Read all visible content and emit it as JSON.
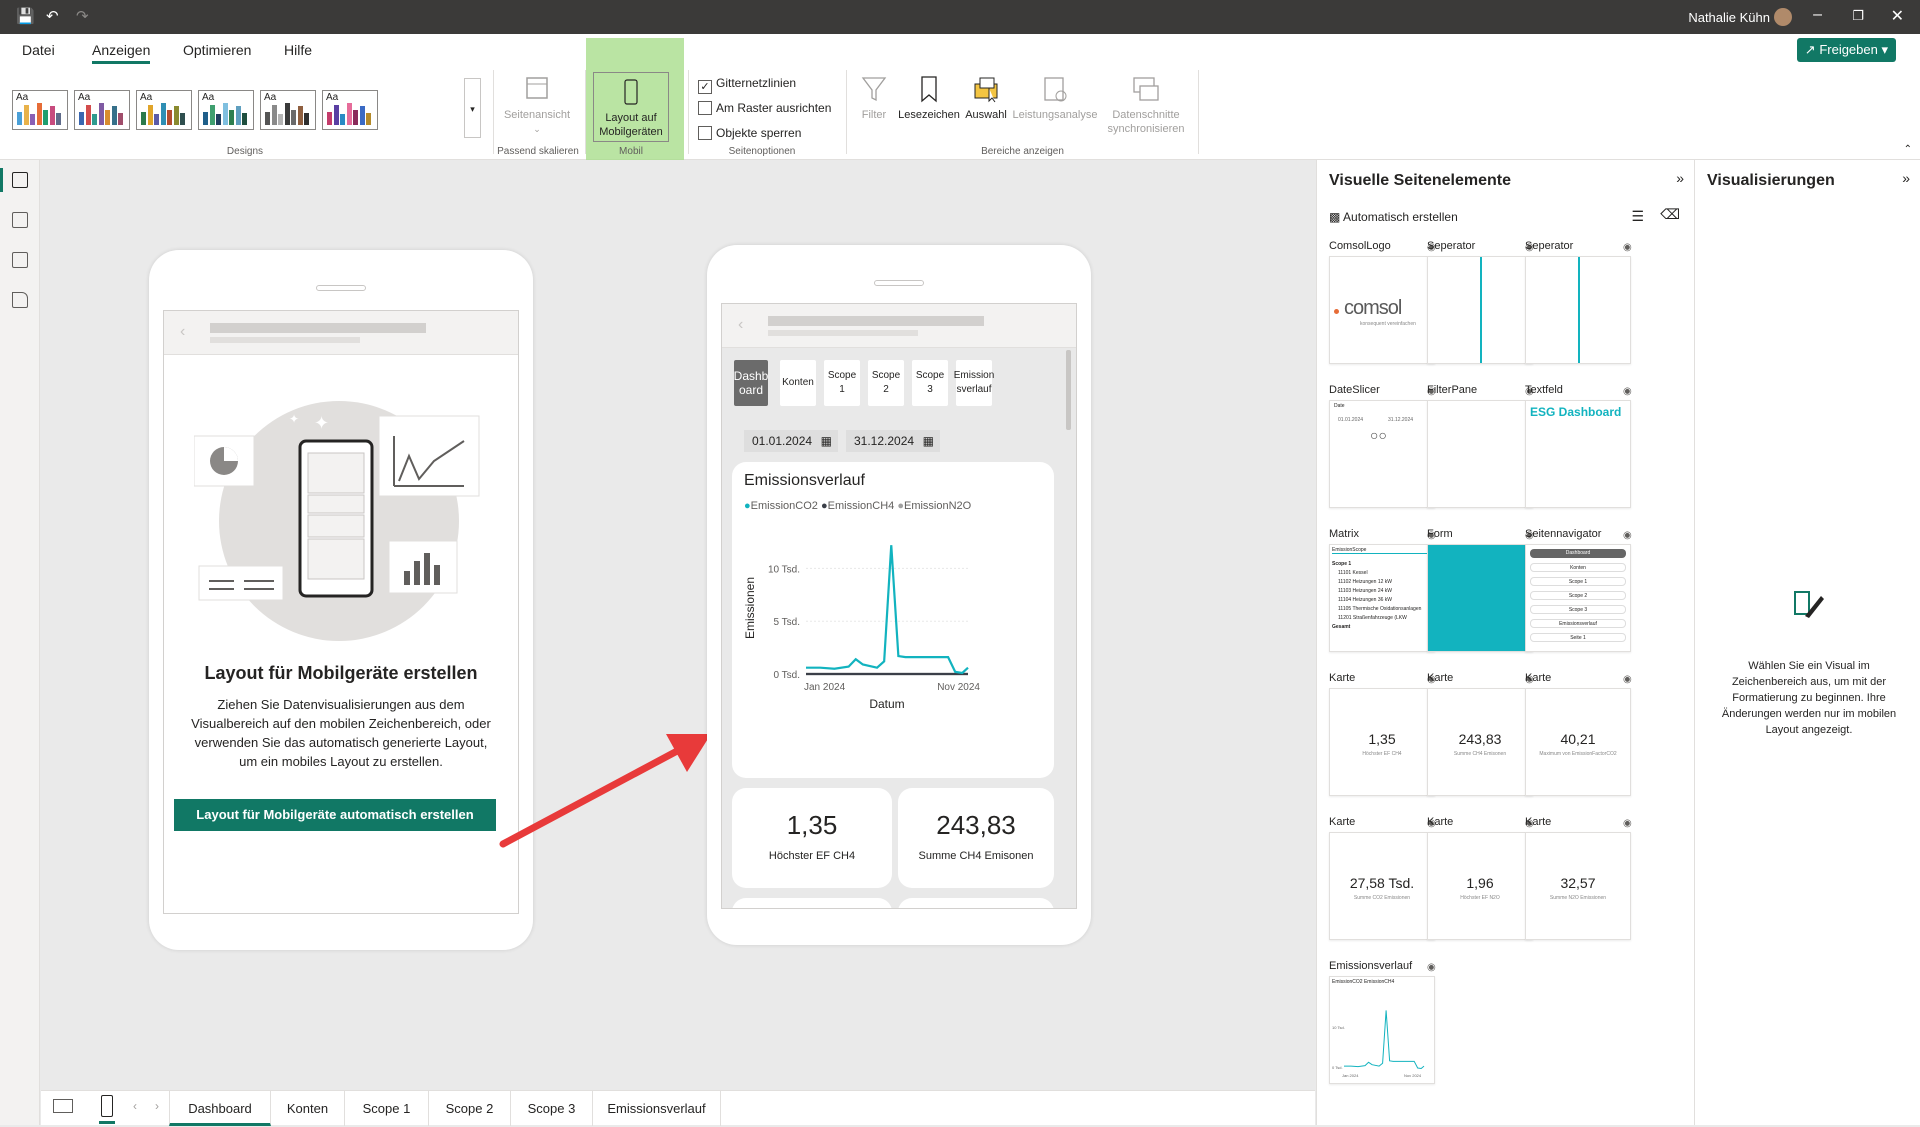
{
  "titlebar": {
    "user": "Nathalie Kühn"
  },
  "menu": {
    "tabs": [
      "Datei",
      "Anzeigen",
      "Optimieren",
      "Hilfe"
    ],
    "active": "Anzeigen",
    "share_label": "Freigeben"
  },
  "ribbon": {
    "groups": {
      "designs": "Designs",
      "fit": "Passend skalieren",
      "mobile": "Mobil",
      "pageopts": "Seitenoptionen",
      "panes": "Bereiche anzeigen"
    },
    "theme_label": "Aa",
    "page_view": "Seitenansicht",
    "mobile_layout": "Layout auf Mobilgeräten",
    "checkboxes": [
      {
        "label": "Gitternetzlinien",
        "checked": true
      },
      {
        "label": "Am Raster ausrichten",
        "checked": false
      },
      {
        "label": "Objekte sperren",
        "checked": false
      }
    ],
    "pane_buttons": [
      "Filter",
      "Lesezeichen",
      "Auswahl",
      "Leistungsanalyse",
      "Datenschnitte synchronisieren"
    ],
    "accent": "#117865",
    "highlight": "#a9dd8c"
  },
  "left_phone": {
    "heading": "Layout für Mobilgeräte erstellen",
    "body": "Ziehen Sie Datenvisualisierungen aus dem Visualbereich auf den mobilen Zeichenbereich, oder verwenden Sie das automatisch generierte Layout, um ein mobiles Layout zu erstellen.",
    "button": "Layout für Mobilgeräte automatisch erstellen"
  },
  "right_phone": {
    "nav": [
      "Dashb oard",
      "Konten",
      "Scope 1",
      "Scope 2",
      "Scope 3",
      "Emission sverlauf"
    ],
    "date_from": "01.01.2024",
    "date_to": "31.12.2024",
    "kpis": [
      {
        "value": "1,35",
        "label": "Höchster EF CH4"
      },
      {
        "value": "243,83",
        "label": "Summe CH4 Emisonen"
      }
    ]
  },
  "chart_data": {
    "type": "line",
    "title": "Emissionsverlauf",
    "xlabel": "Datum",
    "ylabel": "Emissionen",
    "x_ticks": [
      "Jan 2024",
      "Nov 2024"
    ],
    "y_ticks": [
      "0 Tsd.",
      "5 Tsd.",
      "10 Tsd."
    ],
    "ylim": [
      0,
      12500
    ],
    "legend": [
      "EmissionCO2",
      "EmissionCH4",
      "EmissionN2O"
    ],
    "series": [
      {
        "name": "EmissionCO2",
        "color": "#12b3bf",
        "x": [
          0,
          1,
          2,
          3,
          3.5,
          4,
          5,
          5.5,
          6,
          6.5,
          7,
          7.5,
          8,
          9,
          10,
          10.5,
          11,
          11.4
        ],
        "values": [
          600,
          600,
          500,
          700,
          1400,
          900,
          600,
          1200,
          12200,
          1700,
          1600,
          1600,
          1600,
          1600,
          1600,
          200,
          100,
          600
        ]
      },
      {
        "name": "EmissionCH4",
        "color": "#3b3f48",
        "x": [
          0,
          11.4
        ],
        "values": [
          0,
          0
        ]
      },
      {
        "name": "EmissionN2O",
        "color": "#a0a0a0",
        "x": [
          0,
          11.4
        ],
        "values": [
          0,
          0
        ]
      }
    ]
  },
  "visuals_pane": {
    "title": "Visuelle Seitenelemente",
    "auto_create": "Automatisch erstellen",
    "items": [
      {
        "label": "ComsolLogo",
        "kind": "logo",
        "content": "comsol",
        "sub": "konsequent vereinfachen"
      },
      {
        "label": "Seperator",
        "kind": "separator"
      },
      {
        "label": "Seperator",
        "kind": "separator"
      },
      {
        "label": "DateSlicer",
        "kind": "slicer",
        "content": "Date",
        "d1": "01.01.2024",
        "d2": "31.12.2024"
      },
      {
        "label": "FilterPane",
        "kind": "blank"
      },
      {
        "label": "Textfeld",
        "kind": "text",
        "content": "ESG Dashboard"
      },
      {
        "label": "Matrix",
        "kind": "matrix",
        "content": "EmissionScope",
        "rows": [
          "Scope 1",
          "11101 Kessel",
          "11102 Heizungen 12 kW",
          "11103 Heizungen 24 kW",
          "11104 Heizungen 36 kW",
          "11105 Thermische Oxidationsanlagen",
          "11201 Straßenfahrzeuge (LKW",
          "Gesamt"
        ]
      },
      {
        "label": "Form",
        "kind": "shape"
      },
      {
        "label": "Seitennavigator",
        "kind": "nav",
        "rows": [
          "Dashboard",
          "Konten",
          "Scope 1",
          "Scope 2",
          "Scope 3",
          "Emissionsverlauf",
          "Seite 1"
        ]
      },
      {
        "label": "Karte",
        "kind": "card",
        "value": "1,35",
        "sub": "Höchster EF CH4"
      },
      {
        "label": "Karte",
        "kind": "card",
        "value": "243,83",
        "sub": "Summe CH4 Emisonen"
      },
      {
        "label": "Karte",
        "kind": "card",
        "value": "40,21",
        "sub": "Maximum von EmissionFactorCO2"
      },
      {
        "label": "Karte",
        "kind": "card",
        "value": "27,58 Tsd.",
        "sub": "Summe CO2 Emissionen"
      },
      {
        "label": "Karte",
        "kind": "card",
        "value": "1,96",
        "sub": "Höchster EF N2O"
      },
      {
        "label": "Karte",
        "kind": "card",
        "value": "32,57",
        "sub": "Summe N2O Emissionen"
      },
      {
        "label": "Emissionsverlauf",
        "kind": "chart",
        "l1": "EmissionCO2",
        "l2": "EmissionCH4",
        "y": "10 Tsd.",
        "y0": "0 Tsd.",
        "x1": "Jan 2024",
        "x2": "Nov 2024",
        "xl": "Datum",
        "yl": "Emissionen"
      }
    ]
  },
  "viz_pane": {
    "title": "Visualisierungen",
    "hint": "Wählen Sie ein Visual im Zeichenbereich aus, um mit der Formatierung zu beginnen. Ihre Änderungen werden nur im mobilen Layout angezeigt."
  },
  "page_tabs": [
    "Dashboard",
    "Konten",
    "Scope 1",
    "Scope 2",
    "Scope 3",
    "Emissionsverlauf"
  ]
}
